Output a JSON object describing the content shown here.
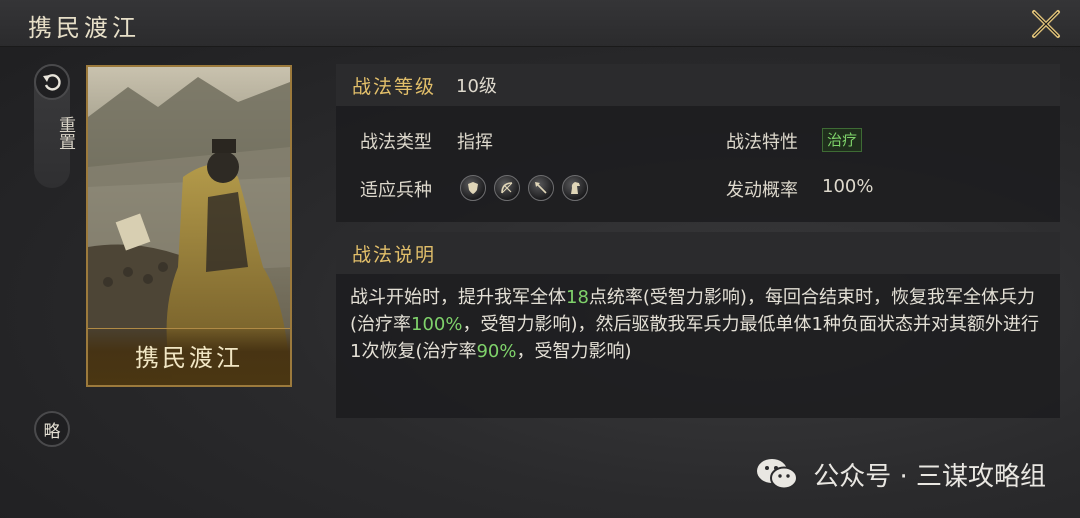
{
  "window": {
    "title": "携民渡江"
  },
  "sidebar": {
    "reset_label": "重置",
    "strategy_label": "略"
  },
  "card": {
    "name": "携民渡江"
  },
  "info": {
    "level_label": "战法等级",
    "level_value": "10级",
    "type_label": "战法类型",
    "type_value": "指挥",
    "trait_label": "战法特性",
    "trait_value": "治疗",
    "troops_label": "适应兵种",
    "troop_icons": [
      "shield-icon",
      "bow-icon",
      "spear-icon",
      "horse-icon"
    ],
    "chance_label": "发动概率",
    "chance_value": "100%"
  },
  "description": {
    "header": "战法说明",
    "parts": {
      "p1": "战斗开始时，提升我军全体",
      "n1": "18",
      "p2": "点统率(受智力影响)，每回合结束时，恢复我军全体兵力(治疗率",
      "n2": "100%",
      "p3": "，受智力影响)，然后驱散我军兵力最低单体1种负面状态并对其额外进行1次恢复(治疗率",
      "n3": "90%",
      "p4": "，受智力影响)"
    }
  },
  "watermark": {
    "text": "公众号 · 三谋攻略组"
  },
  "colors": {
    "accent_gold": "#e2bf6a",
    "highlight_green": "#7fd26b",
    "card_border": "#9c7a3c"
  }
}
